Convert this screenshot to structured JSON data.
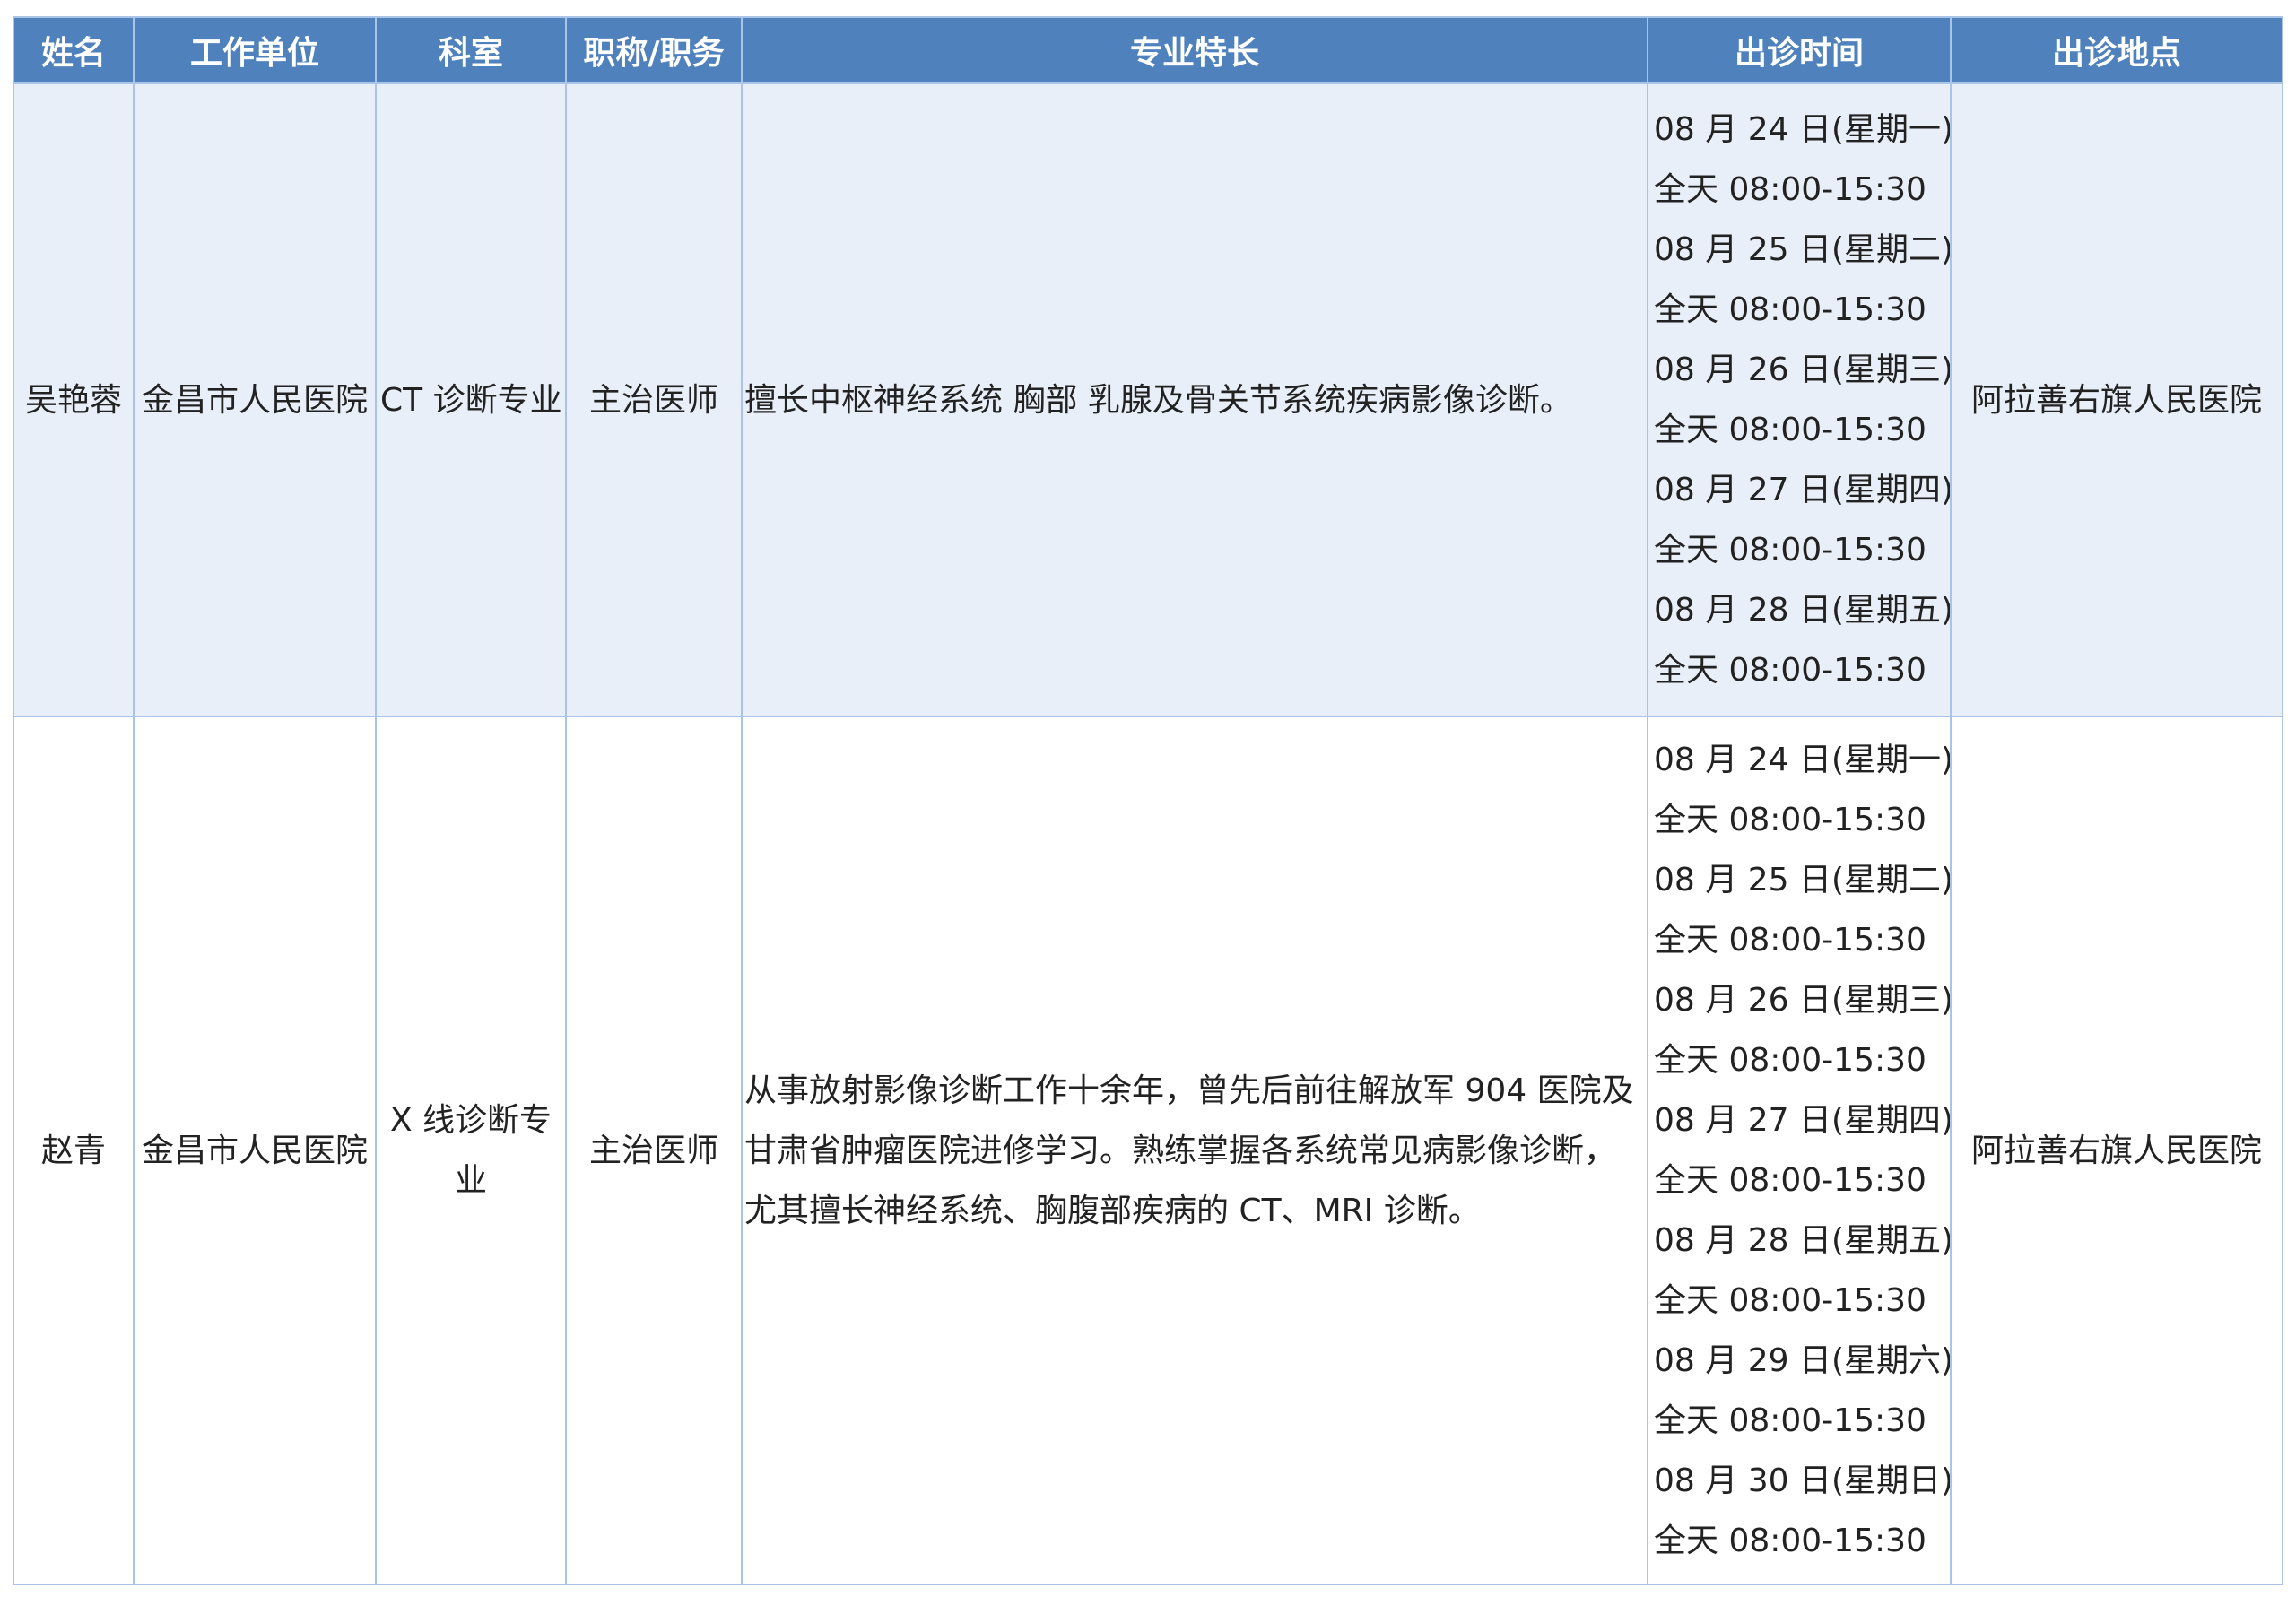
{
  "table": {
    "headers": [
      "姓名",
      "工作单位",
      "科室",
      "职称/职务",
      "专业特长",
      "出诊时间",
      "出诊地点"
    ],
    "rows": [
      {
        "name": "吴艳蓉",
        "unit": "金昌市人民医院",
        "dept": "CT 诊断专业",
        "title": "主治医师",
        "specialty": "擅长中枢神经系统 胸部 乳腺及骨关节系统疾病影像诊断。",
        "schedule": [
          "08 月 24 日(星期一)",
          "全天 08:00-15:30",
          "08 月 25 日(星期二)",
          "全天 08:00-15:30",
          "08 月 26 日(星期三)",
          "全天 08:00-15:30",
          "08 月 27 日(星期四)",
          "全天 08:00-15:30",
          "08 月 28 日(星期五)",
          "全天 08:00-15:30"
        ],
        "location": "阿拉善右旗人民医院"
      },
      {
        "name": "赵青",
        "unit": "金昌市人民医院",
        "dept": "X 线诊断专业",
        "title": "主治医师",
        "specialty": "从事放射影像诊断工作十余年，曾先后前往解放军 904 医院及甘肃省肿瘤医院进修学习。熟练掌握各系统常见病影像诊断，尤其擅长神经系统、胸腹部疾病的 CT、MRI 诊断。",
        "schedule": [
          "08 月 24 日(星期一)",
          "全天 08:00-15:30",
          "08 月 25 日(星期二)",
          "全天 08:00-15:30",
          "08 月 26 日(星期三)",
          "全天 08:00-15:30",
          "08 月 27 日(星期四)",
          "全天 08:00-15:30",
          "08 月 28 日(星期五)",
          "全天 08:00-15:30",
          "08 月 29 日(星期六)",
          "全天 08:00-15:30",
          "08 月 30 日(星期日)",
          "全天 08:00-15:30"
        ],
        "location": "阿拉善右旗人民医院"
      }
    ]
  },
  "colors": {
    "header_bg": "#4f81bd",
    "header_text": "#ffffff",
    "border": "#a9c4e6",
    "alt_row_bg": "#e9eff8"
  }
}
